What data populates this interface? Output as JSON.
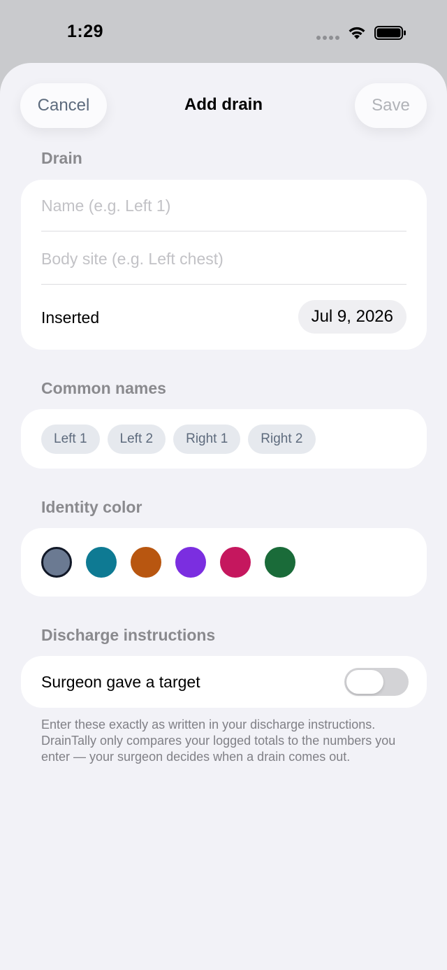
{
  "status_bar": {
    "time": "1:29"
  },
  "nav": {
    "cancel_label": "Cancel",
    "title": "Add drain",
    "save_label": "Save"
  },
  "drain_section": {
    "label": "Drain",
    "name_placeholder": "Name (e.g. Left 1)",
    "body_site_placeholder": "Body site (e.g. Left chest)",
    "inserted_label": "Inserted",
    "inserted_date": "Jul 9, 2026"
  },
  "common_names": {
    "label": "Common names",
    "chips": [
      "Left 1",
      "Left 2",
      "Right 1",
      "Right 2"
    ]
  },
  "identity_color": {
    "label": "Identity color",
    "selected_index": 0,
    "colors": [
      "#6b7a92",
      "#0e7a93",
      "#b85610",
      "#7b2ee0",
      "#c5175e",
      "#1a6b39"
    ]
  },
  "discharge": {
    "label": "Discharge instructions",
    "toggle_label": "Surgeon gave a target",
    "toggle_on": false,
    "footnote": "Enter these exactly as written in your discharge instructions. DrainTally only compares your logged totals to the numbers you enter — your surgeon decides when a drain comes out."
  }
}
